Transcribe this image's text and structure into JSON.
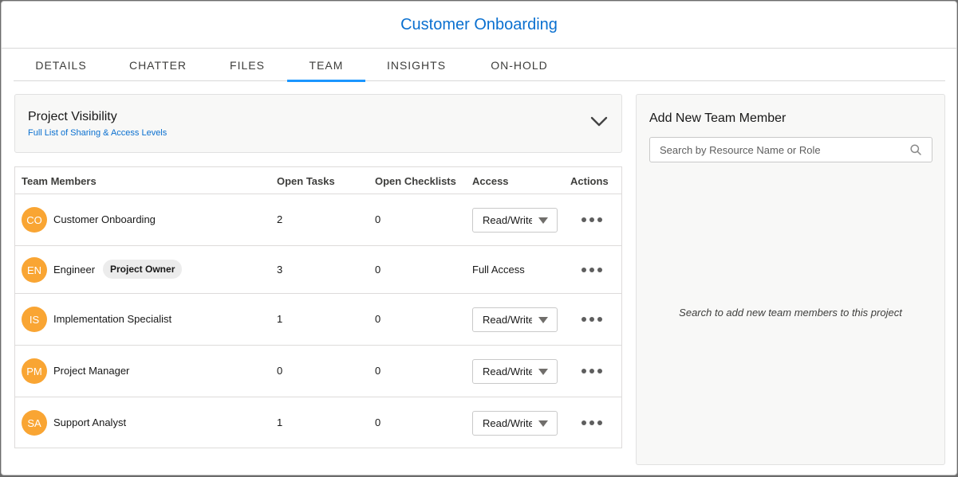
{
  "modal": {
    "title": "Customer Onboarding"
  },
  "tabs": [
    {
      "label": "DETAILS"
    },
    {
      "label": "CHATTER"
    },
    {
      "label": "FILES"
    },
    {
      "label": "TEAM",
      "active": true
    },
    {
      "label": "INSIGHTS"
    },
    {
      "label": "ON-HOLD"
    }
  ],
  "visibility": {
    "title": "Project Visibility",
    "link": "Full List of Sharing & Access Levels",
    "toggle_icon": "chevron-down-icon"
  },
  "team": {
    "headers": {
      "members": "Team Members",
      "open_tasks": "Open Tasks",
      "open_checklists": "Open Checklists",
      "access": "Access",
      "actions": "Actions"
    },
    "rows": [
      {
        "initials": "CO",
        "name": "Customer Onboarding",
        "badge": "",
        "open_tasks": "2",
        "open_checklists": "0",
        "access": "Read/Write",
        "access_type": "select"
      },
      {
        "initials": "EN",
        "name": "Engineer",
        "badge": "Project Owner",
        "open_tasks": "3",
        "open_checklists": "0",
        "access": "Full Access",
        "access_type": "text"
      },
      {
        "initials": "IS",
        "name": "Implementation Specialist",
        "badge": "",
        "open_tasks": "1",
        "open_checklists": "0",
        "access": "Read/Write",
        "access_type": "select"
      },
      {
        "initials": "PM",
        "name": "Project Manager",
        "badge": "",
        "open_tasks": "0",
        "open_checklists": "0",
        "access": "Read/Write",
        "access_type": "select"
      },
      {
        "initials": "SA",
        "name": "Support Analyst",
        "badge": "",
        "open_tasks": "1",
        "open_checklists": "0",
        "access": "Read/Write",
        "access_type": "select"
      }
    ]
  },
  "add_member": {
    "title": "Add New Team Member",
    "search_placeholder": "Search by Resource Name or Role",
    "empty_message": "Search to add new team members to this project"
  },
  "colors": {
    "accent": "#0a70d0",
    "tab_underline": "#1b96ff",
    "avatar": "#f9a533"
  }
}
